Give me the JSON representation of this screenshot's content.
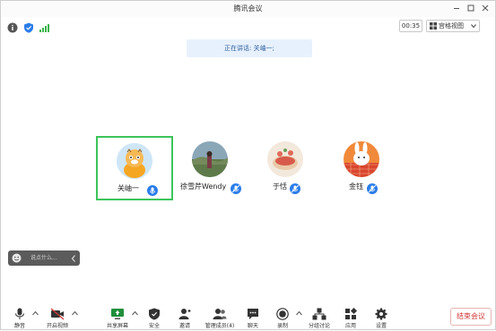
{
  "window": {
    "title": "腾讯会议"
  },
  "topbar": {
    "timer": "00:35",
    "view_label": "宫格视图"
  },
  "speaking": {
    "text": "正在讲话: 关岫一;"
  },
  "participants": [
    {
      "name": "关岫一",
      "avatar": "tiger-cartoon",
      "active": true
    },
    {
      "name": "徐雪芹Wendy",
      "avatar": "landscape-photo",
      "active": false
    },
    {
      "name": "于恬",
      "avatar": "food-illustration",
      "active": false
    },
    {
      "name": "金钰",
      "avatar": "rabbit-cartoon",
      "active": false
    }
  ],
  "chat": {
    "placeholder": "说点什么..."
  },
  "toolbar": {
    "mute": "静音",
    "video": "开启视频",
    "share": "共享屏幕",
    "security": "安全",
    "invite": "邀请",
    "members": "管理成员(4)",
    "chat": "聊天",
    "record": "录制",
    "breakout": "分组讨论",
    "apps": "应用",
    "settings": "设置",
    "end": "结束会议"
  },
  "colors": {
    "accent": "#2b7de9",
    "active_border": "#3cc45a",
    "end_red": "#d23a3a"
  }
}
